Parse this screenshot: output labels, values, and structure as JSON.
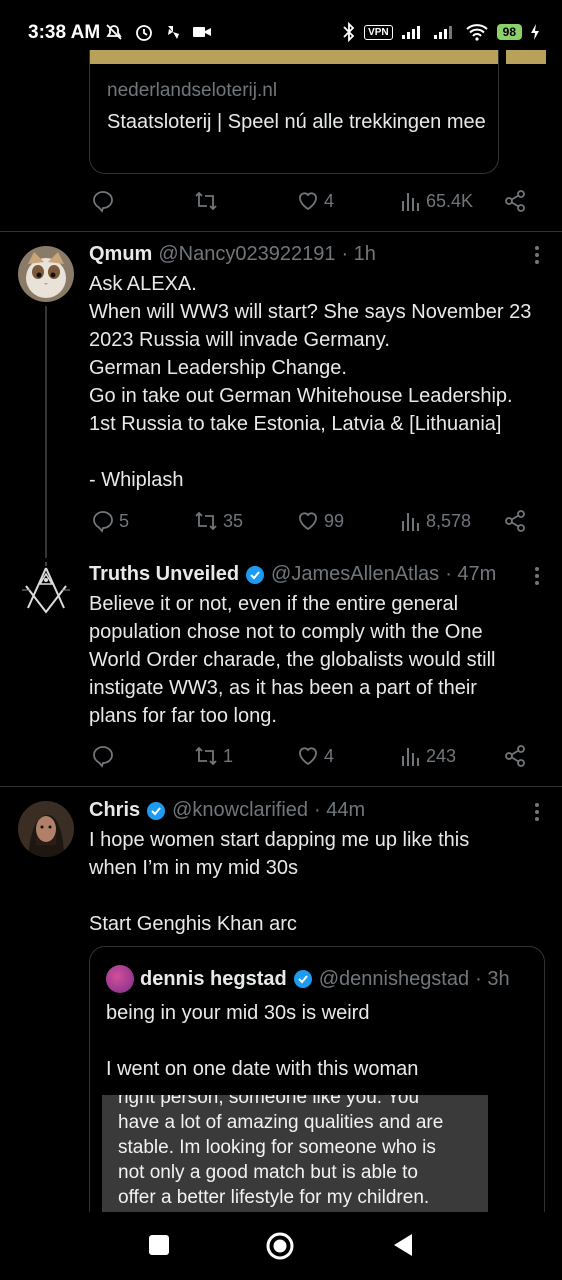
{
  "status_bar": {
    "time": "3:38 AM",
    "vpn": "VPN",
    "battery": "98"
  },
  "link_card": {
    "domain": "nederlandseloterij.nl",
    "title": "Staatsloterij | Speel nú alle trekkingen mee"
  },
  "tweet0_actions": {
    "replies": "",
    "retweets": "",
    "likes": "4",
    "views": "65.4K"
  },
  "tweet1": {
    "name": "Qmum",
    "handle": "@Nancy023922191",
    "time": "· 1h",
    "lines": [
      "Ask ALEXA.",
      "When will WW3 will start? She says November 23 2023 Russia will invade Germany.",
      "German Leadership Change.",
      "Go in take out German Whitehouse Leadership.",
      "1st Russia to take Estonia, Latvia & [Lithuania]",
      "",
      "- Whiplash"
    ],
    "actions": {
      "replies": "5",
      "retweets": "35",
      "likes": "99",
      "views": "8,578"
    }
  },
  "tweet2": {
    "name": "Truths Unveiled",
    "handle": "@JamesAllenAtlas",
    "time": "· 47m",
    "text": "Believe it or not, even if the entire general population chose not to comply with the One World Order charade, the globalists would still instigate WW3, as it has been a part of their plans for far too long.",
    "actions": {
      "replies": "",
      "retweets": "1",
      "likes": "4",
      "views": "243"
    }
  },
  "tweet3": {
    "name": "Chris",
    "handle": "@knowclarified",
    "time": "· 44m",
    "lines": [
      "I hope women start dapping me up like this when I’m in my mid 30s",
      "",
      "Start Genghis Khan arc"
    ]
  },
  "quote": {
    "name": "dennis hegstad",
    "handle": "@dennishegstad",
    "time": "· 3h",
    "lines": [
      "being in your mid 30s is weird",
      "",
      "I went on one date with this woman"
    ],
    "image_lines": [
      "right person, someone like you. You",
      "have a lot of amazing qualities and are",
      "stable. Im looking for someone who is",
      "not only a good match but is able to",
      "offer a better lifestyle for my children."
    ]
  },
  "colors": {
    "background": "#000000",
    "text": "#e7e9ea",
    "secondary": "#71767b",
    "verified": "#1d9bf0",
    "divider": "#2f3336"
  }
}
